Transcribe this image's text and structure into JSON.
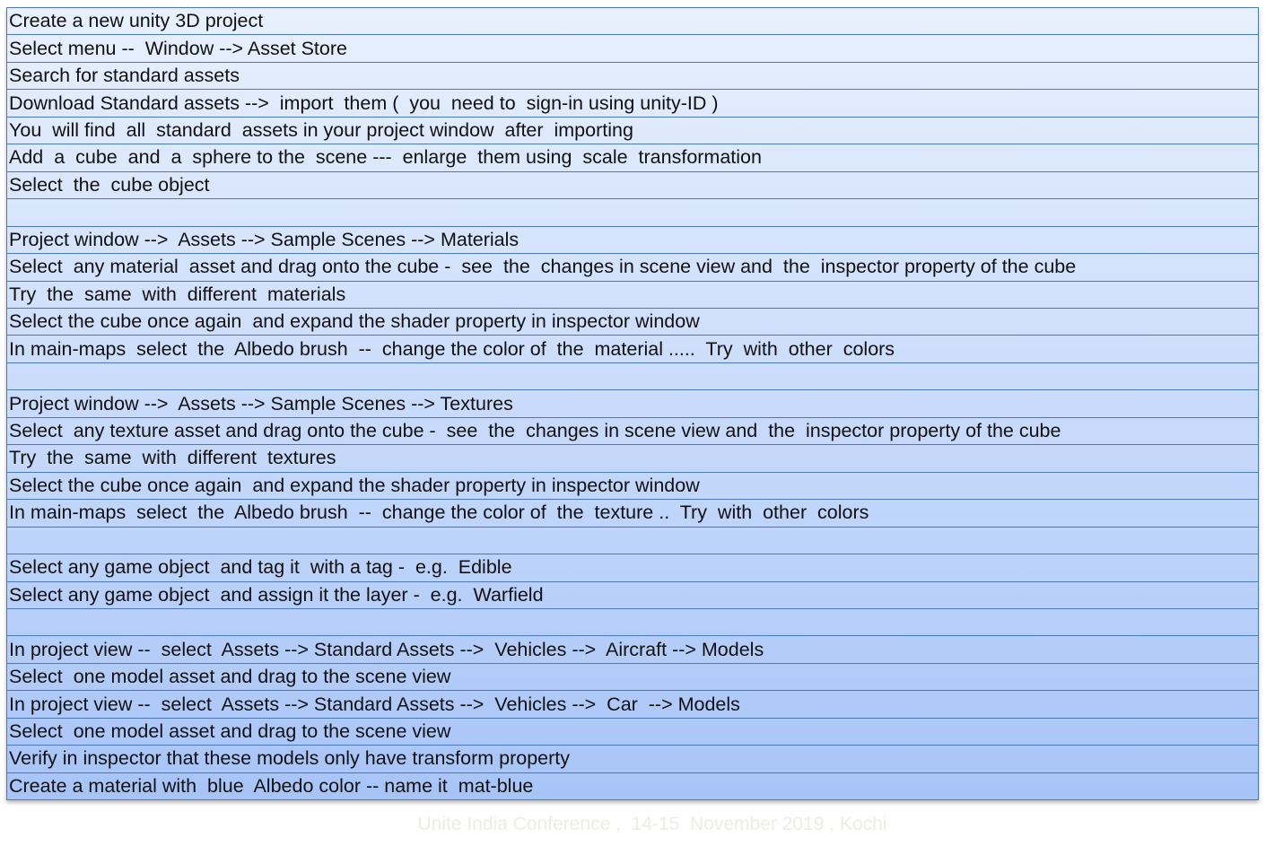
{
  "rows": [
    "Create a new unity 3D project",
    "Select menu --  Window --> Asset Store",
    "Search for standard assets",
    "Download Standard assets -->  import  them (  you  need to  sign-in using unity-ID )",
    "You  will find  all  standard  assets in your project window  after  importing",
    "Add  a  cube  and  a  sphere to the  scene ---  enlarge  them using  scale  transformation",
    "Select  the  cube object",
    "",
    "Project window -->  Assets --> Sample Scenes --> Materials",
    "Select  any material  asset and drag onto the cube -  see  the  changes in scene view and  the  inspector property of the cube",
    "Try  the  same  with  different  materials",
    "Select the cube once again  and expand the shader property in inspector window",
    "In main-maps  select  the  Albedo brush  --  change the color of  the  material .....  Try  with  other  colors",
    "",
    "Project window -->  Assets --> Sample Scenes --> Textures",
    "Select  any texture asset and drag onto the cube -  see  the  changes in scene view and  the  inspector property of the cube",
    "Try  the  same  with  different  textures",
    "Select the cube once again  and expand the shader property in inspector window",
    "In main-maps  select  the  Albedo brush  --  change the color of  the  texture ..  Try  with  other  colors",
    "",
    "Select any game object  and tag it  with a tag -  e.g.  Edible",
    "Select any game object  and assign it the layer -  e.g.  Warfield",
    "",
    "In project view --  select  Assets --> Standard Assets -->  Vehicles -->  Aircraft --> Models",
    "Select  one model asset and drag to the scene view",
    "In project view --  select  Assets --> Standard Assets -->  Vehicles -->  Car  --> Models",
    "Select  one model asset and drag to the scene view",
    "Verify in inspector that these models only have transform property",
    "Create a material with  blue  Albedo color -- name it  mat-blue"
  ],
  "footer": "Unite India Conference ,  14-15  November 2019 , Kochi",
  "colors": {
    "table_border": "#4a78b8",
    "gradient_top": "#e8f0fd",
    "gradient_bottom": "#a7c4f7",
    "footer_text": "#ecede7"
  }
}
